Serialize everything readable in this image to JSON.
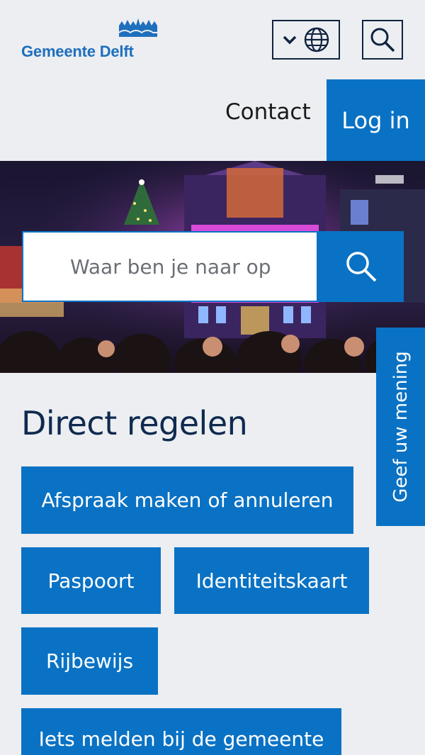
{
  "header": {
    "logo_text": "Gemeente Delft",
    "contact_label": "Contact",
    "login_label": "Log in"
  },
  "search": {
    "placeholder": "Waar ben je naar op"
  },
  "feedback": {
    "label": "Geef uw mening"
  },
  "direct": {
    "title": "Direct regelen",
    "tiles": [
      "Afspraak maken of annuleren",
      "Paspoort",
      "Identiteitskaart",
      "Rijbewijs",
      "Iets melden bij de gemeente"
    ]
  },
  "colors": {
    "brand_blue": "#0a72c4",
    "navy": "#0f2a4f",
    "background": "#eceef1"
  },
  "icons": [
    "delft-crown-logo",
    "chevron-down-icon",
    "globe-icon",
    "search-icon"
  ]
}
